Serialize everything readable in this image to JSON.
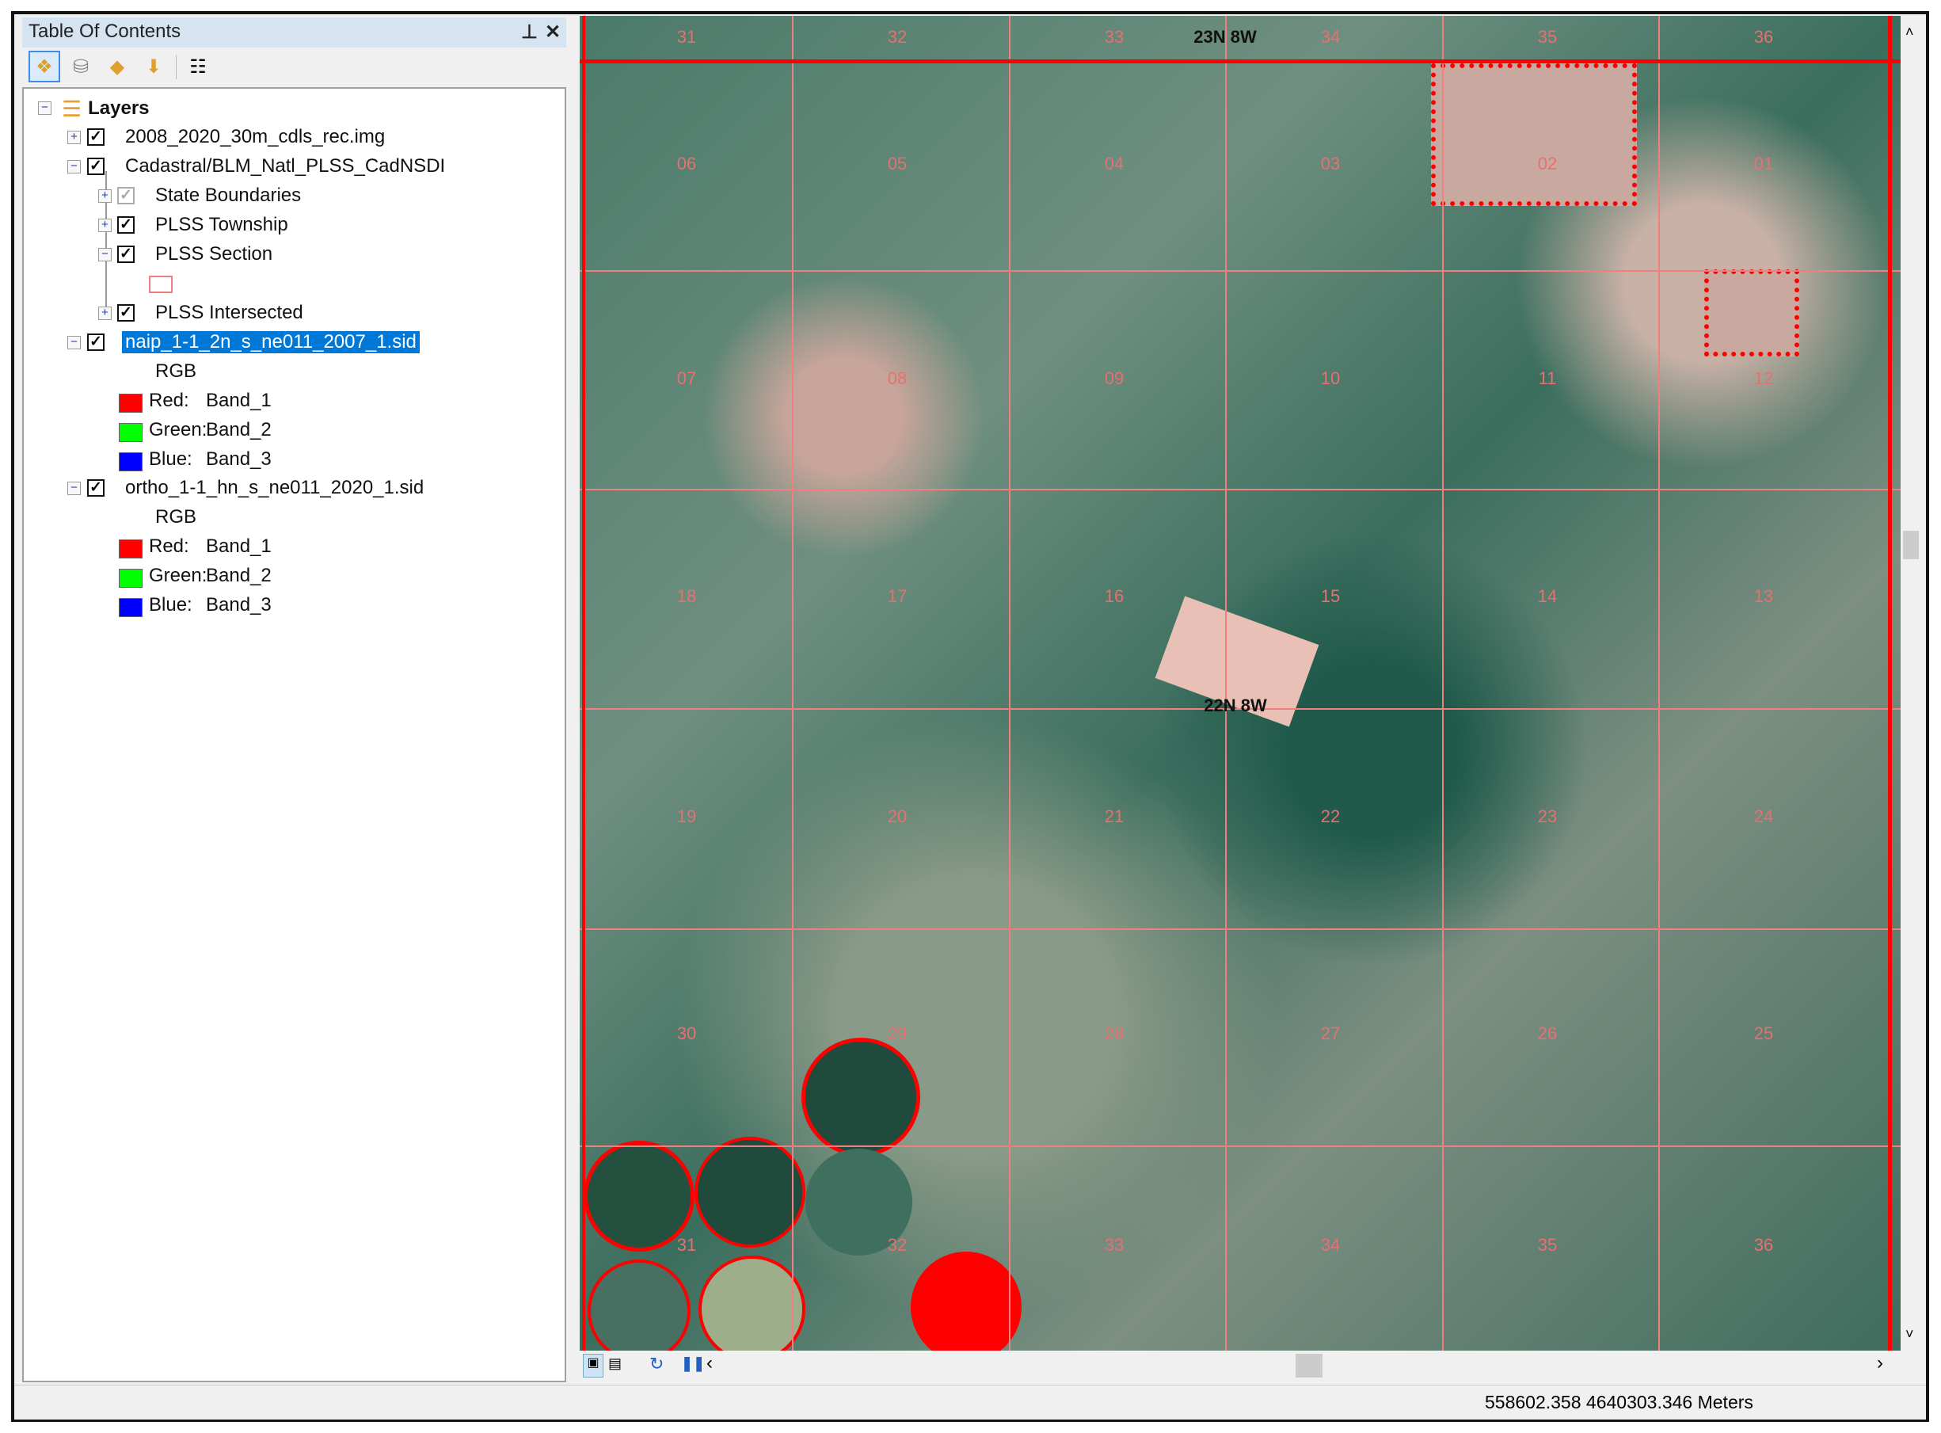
{
  "toc": {
    "title": "Table Of Contents",
    "pin_icon": "pin-icon",
    "close_icon": "close-icon",
    "toolbar": [
      "list-by-drawing-order",
      "list-by-source",
      "list-by-visibility",
      "list-by-selection",
      "options"
    ],
    "root": "Layers",
    "layers": [
      {
        "name": "2008_2020_30m_cdls_rec.img",
        "checked": true,
        "expanded": false
      },
      {
        "name": "Cadastral/BLM_Natl_PLSS_CadNSDI",
        "checked": true,
        "expanded": true,
        "sublayers": [
          {
            "name": "State Boundaries",
            "checked": true,
            "dimmed": true
          },
          {
            "name": "PLSS Township",
            "checked": true
          },
          {
            "name": "PLSS Section",
            "checked": true,
            "symbol_color": "#f08080"
          },
          {
            "name": "PLSS Intersected",
            "checked": true
          }
        ]
      },
      {
        "name": "naip_1-1_2n_s_ne011_2007_1.sid",
        "checked": true,
        "selected": true,
        "renderer": "RGB",
        "bands": [
          {
            "label": "Red:",
            "band": "Band_1",
            "color": "#ff0000"
          },
          {
            "label": "Green:",
            "band": "Band_2",
            "color": "#00ff00"
          },
          {
            "label": "Blue:",
            "band": "Band_3",
            "color": "#0000ff"
          }
        ]
      },
      {
        "name": "ortho_1-1_hn_s_ne011_2020_1.sid",
        "checked": true,
        "renderer": "RGB",
        "bands": [
          {
            "label": "Red:",
            "band": "Band_1",
            "color": "#ff0000"
          },
          {
            "label": "Green:",
            "band": "Band_2",
            "color": "#00ff00"
          },
          {
            "label": "Blue:",
            "band": "Band_3",
            "color": "#0000ff"
          }
        ]
      }
    ]
  },
  "map": {
    "townships": [
      "23N 8W",
      "22N 8W"
    ],
    "section_rows": [
      [
        "31",
        "32",
        "33",
        "34",
        "35",
        "36"
      ],
      [
        "06",
        "05",
        "04",
        "03",
        "02",
        "01"
      ],
      [
        "07",
        "08",
        "09",
        "10",
        "11",
        "12"
      ],
      [
        "18",
        "17",
        "16",
        "15",
        "14",
        "13"
      ],
      [
        "19",
        "20",
        "21",
        "22",
        "23",
        "24"
      ],
      [
        "30",
        "29",
        "28",
        "27",
        "26",
        "25"
      ],
      [
        "31",
        "32",
        "33",
        "34",
        "35",
        "36"
      ]
    ]
  },
  "status": {
    "coordinates": "558602.358  4640303.346 Meters"
  }
}
